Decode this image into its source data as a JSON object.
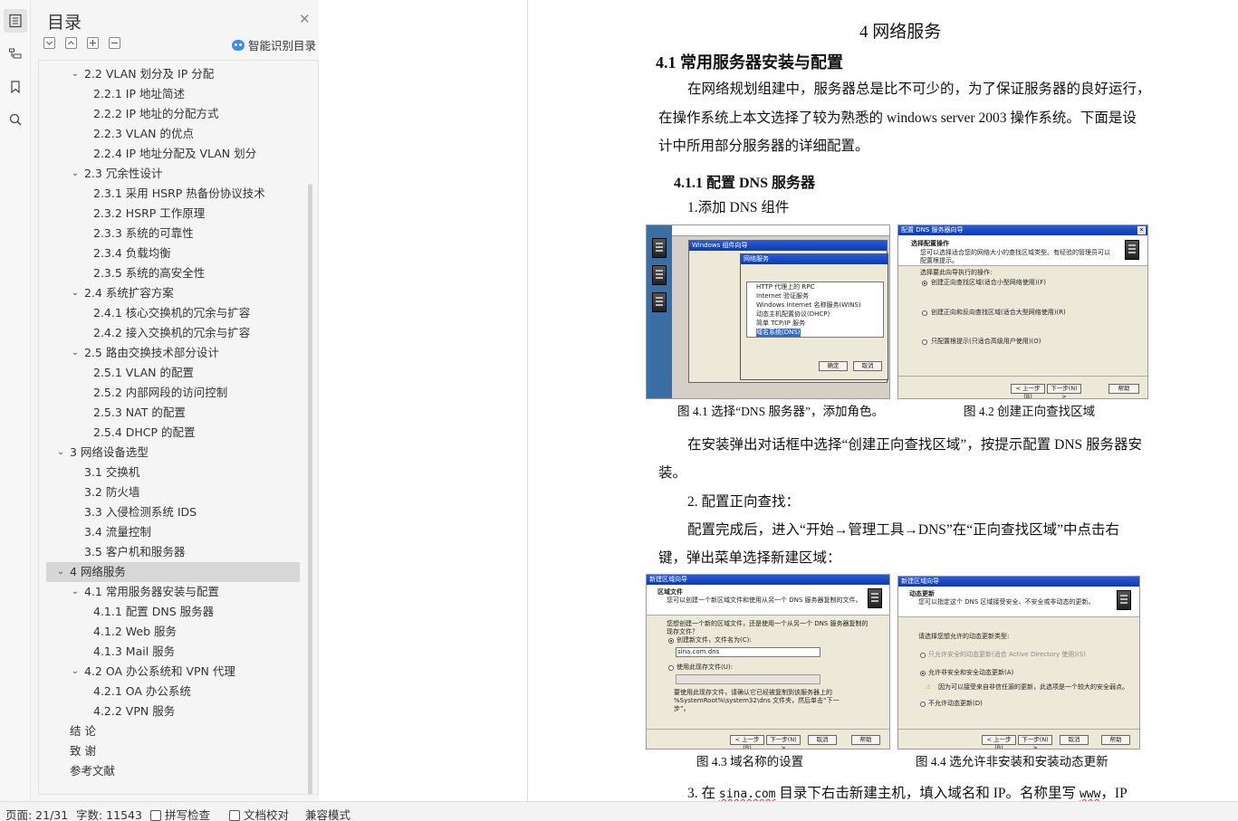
{
  "toc": {
    "title": "目录",
    "smart_label": "智能识别目录",
    "items": [
      {
        "label": "2.2 VLAN 划分及 IP 分配",
        "level": 2,
        "expanded": true
      },
      {
        "label": "2.2.1 IP 地址简述",
        "level": 3
      },
      {
        "label": "2.2.2 IP 地址的分配方式",
        "level": 3
      },
      {
        "label": "2.2.3 VLAN 的优点",
        "level": 3
      },
      {
        "label": "2.2.4 IP 地址分配及 VLAN 划分",
        "level": 3
      },
      {
        "label": "2.3 冗余性设计",
        "level": 2,
        "expanded": true
      },
      {
        "label": "2.3.1 采用 HSRP 热备份协议技术",
        "level": 3
      },
      {
        "label": "2.3.2 HSRP 工作原理",
        "level": 3
      },
      {
        "label": "2.3.3 系统的可靠性",
        "level": 3
      },
      {
        "label": "2.3.4 负载均衡",
        "level": 3
      },
      {
        "label": "2.3.5 系统的高安全性",
        "level": 3
      },
      {
        "label": "2.4 系统扩容方案",
        "level": 2,
        "expanded": true
      },
      {
        "label": "2.4.1 核心交换机的冗余与扩容",
        "level": 3
      },
      {
        "label": "2.4.2 接入交换机的冗余与扩容",
        "level": 3
      },
      {
        "label": "2.5 路由交换技术部分设计",
        "level": 2,
        "expanded": true
      },
      {
        "label": "2.5.1 VLAN 的配置",
        "level": 3
      },
      {
        "label": "2.5.2 内部网段的访问控制",
        "level": 3
      },
      {
        "label": "2.5.3 NAT 的配置",
        "level": 3
      },
      {
        "label": "2.5.4 DHCP 的配置",
        "level": 3
      },
      {
        "label": "3 网络设备选型",
        "level": 1,
        "expanded": true
      },
      {
        "label": "3.1 交换机",
        "level": 2
      },
      {
        "label": "3.2 防火墙",
        "level": 2
      },
      {
        "label": "3.3 入侵检测系统 IDS",
        "level": 2
      },
      {
        "label": "3.4 流量控制",
        "level": 2
      },
      {
        "label": "3.5 客户机和服务器",
        "level": 2
      },
      {
        "label": "4 网络服务",
        "level": 1,
        "expanded": true,
        "selected": true
      },
      {
        "label": "4.1 常用服务器安装与配置",
        "level": 2,
        "expanded": true
      },
      {
        "label": "4.1.1 配置 DNS 服务器",
        "level": 3
      },
      {
        "label": "4.1.2 Web 服务",
        "level": 3
      },
      {
        "label": "4.1.3 Mail 服务",
        "level": 3
      },
      {
        "label": "4.2 OA 办公系统和 VPN 代理",
        "level": 2,
        "expanded": true
      },
      {
        "label": "4.2.1 OA 办公系统",
        "level": 3
      },
      {
        "label": "4.2.2 VPN 服务",
        "level": 3
      },
      {
        "label": "结 论",
        "level": 1
      },
      {
        "label": "致 谢",
        "level": 1
      },
      {
        "label": "参考文献",
        "level": 1
      }
    ]
  },
  "doc": {
    "chapter": "4 网络服务",
    "section": "4.1 常用服务器安装与配置",
    "para1_a": "在网络规划组建中，服务器总是比不可少的，为了保证服务器的良好运行，",
    "para1_b": "在操作系统上本文选择了较为熟悉的 windows server 2003 操作系统。下面是设",
    "para1_c": "计中所用部分服务器的详细配置。",
    "subsection": "4.1.1 配置 DNS 服务器",
    "step1": "1.添加 DNS 组件",
    "cap41": "图 4.1 选择“DNS 服务器”，添加角色。",
    "cap42": "图 4.2 创建正向查找区域",
    "para2_a": "在安装弹出对话框中选择“创建正向查找区域”，按提示配置 DNS 服务器安",
    "para2_b": "装。",
    "step2": "2. 配置正向查找：",
    "para3_a": "配置完成后，进入“开始→管理工具→DNS”在“正向查找区域”中点击右",
    "para3_b": "键，弹出菜单选择新建区域：",
    "cap43": "图 4.3 域名称的设置",
    "cap44": "图 4.4  选允许非安装和安装动态更新",
    "step3_a": "3. 在 ",
    "step3_link": "sina.com",
    "step3_b": " 目录下右击新建主机，填入域名和 IP。名称里写 ",
    "step3_www": "www",
    "step3_c": "，IP",
    "img1": {
      "title": "Windows 组件向导",
      "sub": "网络服务",
      "items": [
        "HTTP 代理上的 RPC",
        "Internet 验证服务",
        "Windows Internet 名称服务(WINS)",
        "动态主机配置协议(DHCP)",
        "简单 TCP/IP 服务",
        "域名系统(DNS)"
      ],
      "ok": "确定",
      "cancel": "取消"
    },
    "img2": {
      "title": "配置 DNS 服务器向导",
      "heading": "选择配置操作",
      "desc": "您可以选择适合您的网络大小的查找区域类型。有经验的管理员可以配置根提示。",
      "prompt": "选择要此向导执行的操作:",
      "opt1": "创建正向查找区域(适合小型网络使用)(F)",
      "opt2": "创建正向和反向查找区域(适合大型网络使用)(R)",
      "opt3": "只配置根提示(只适合高级用户使用)(O)",
      "back": "< 上一步(B)",
      "next": "下一步(N) >",
      "help": "帮助"
    },
    "img3": {
      "title": "新建区域向导",
      "heading": "区域文件",
      "desc": "您可以创建一个新区域文件和使用从另一个 DNS 服务器复制的文件。",
      "prompt": "您想创建一个新的区域文件，还是使用一个从另一个 DNS 服务器复制的现存文件？",
      "opt1": "创建新文件，文件名为(C):",
      "value": "sina.com.dns",
      "opt2": "使用此现存文件(U):",
      "note": "要使用此现存文件，请确认它已经被复制到该服务器上的 %SystemRoot%\\system32\\dns 文件夹，然后单击“下一步”。",
      "back": "< 上一步(B)",
      "next": "下一步(N) >",
      "cancel": "取消",
      "help": "帮助"
    },
    "img4": {
      "title": "新建区域向导",
      "heading": "动态更新",
      "desc": "您可以指定这个 DNS 区域接受安全、不安全或非动态的更新。",
      "prompt": "请选择您想允许的动态更新类型:",
      "opt1": "只允许安全的动态更新(适合 Active Directory 使用)(S)",
      "opt2": "允许非安全和安全动态更新(A)",
      "warn": "因为可以接受来自非信任源的更新，此选项是一个较大的安全弱点。",
      "opt3": "不允许动态更新(D)",
      "back": "< 上一步(B)",
      "next": "下一步(N) >",
      "cancel": "取消",
      "help": "帮助"
    }
  },
  "status": {
    "page": "页面: 21/31",
    "words": "字数: 11543",
    "spell": "拼写检查",
    "proof": "文档校对",
    "compat": "兼容模式"
  },
  "colors": {
    "accent": "#3d8ef0",
    "selected_bg": "#d7d7d7"
  }
}
